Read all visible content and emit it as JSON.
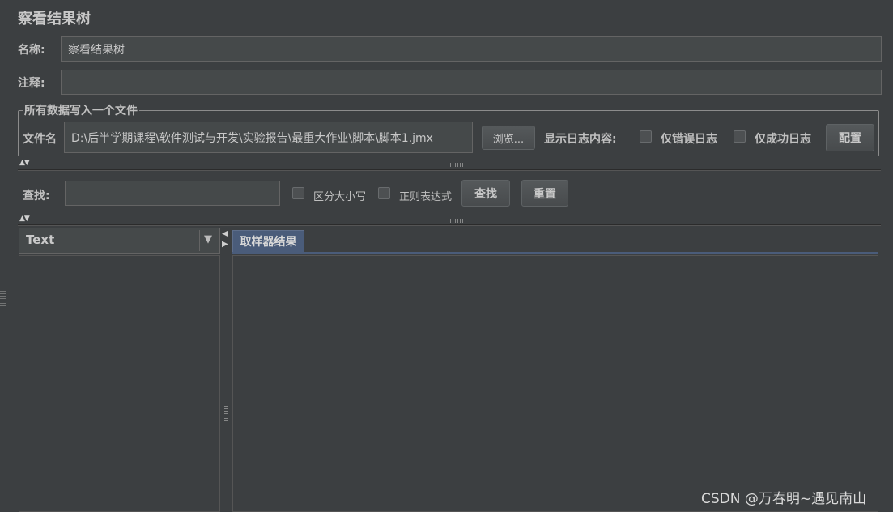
{
  "panel": {
    "title": "察看结果树"
  },
  "name_row": {
    "label": "名称:",
    "value": "察看结果树"
  },
  "comment_row": {
    "label": "注释:",
    "value": ""
  },
  "file_group": {
    "legend": "所有数据写入一个文件",
    "filename_label": "文件名",
    "filename_value": "D:\\后半学期课程\\软件测试与开发\\实验报告\\最重大作业\\脚本\\脚本1.jmx",
    "browse_label": "浏览...",
    "log_content_label": "显示日志内容:",
    "errors_only_label": "仅错误日志",
    "success_only_label": "仅成功日志",
    "configure_label": "配置"
  },
  "search_bar": {
    "label": "查找:",
    "value": "",
    "case_sensitive_label": "区分大小写",
    "regex_label": "正则表达式",
    "search_label": "查找",
    "reset_label": "重置"
  },
  "renderer": {
    "selected": "Text",
    "dropdown_icon": "triangle-down-icon"
  },
  "results": {
    "tab_label": "取样器结果"
  },
  "watermark": "CSDN @万春明~遇见南山",
  "icons": {
    "splitter": "splitter-arrows-icon",
    "grip": "grip-icon"
  },
  "colors": {
    "background": "#3c3f41",
    "field": "#45494a",
    "tab_active": "#4a5c7a",
    "text": "#bbbbbb"
  }
}
